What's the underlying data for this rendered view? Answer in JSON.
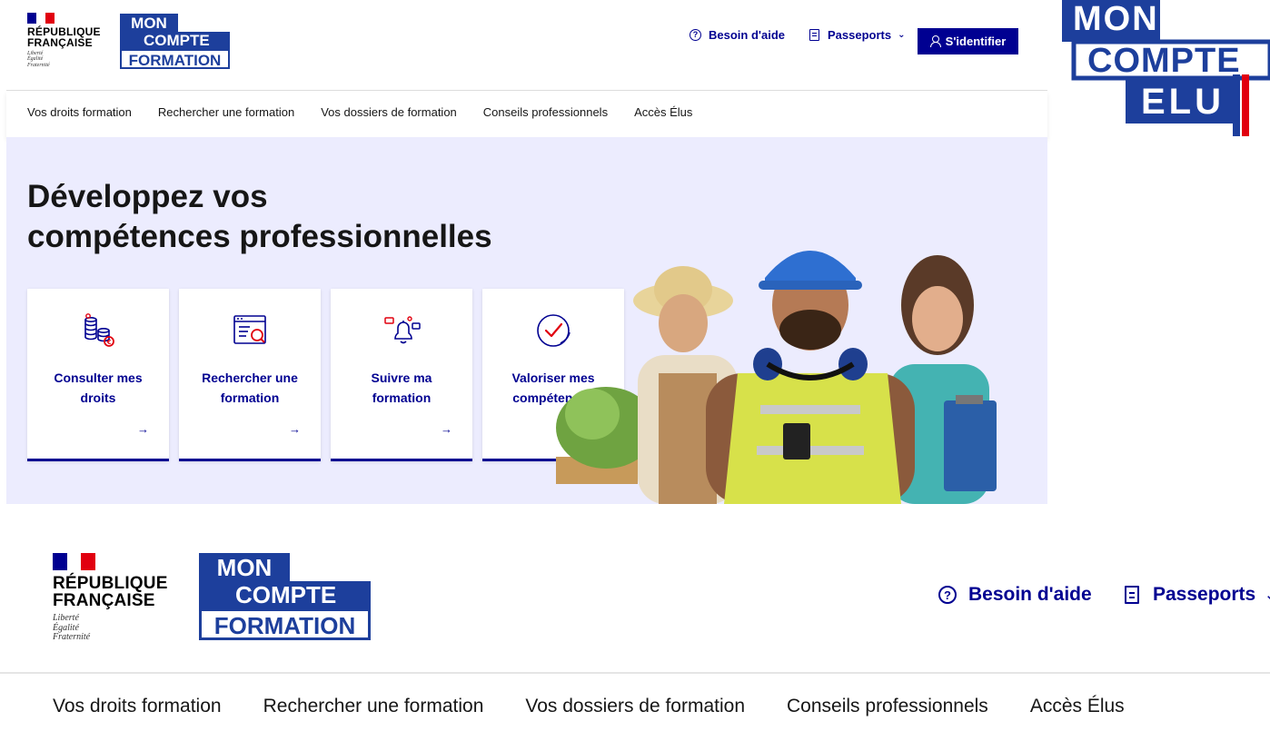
{
  "republic": {
    "line1": "RÉPUBLIQUE",
    "line2": "FRANÇAISE",
    "motto": [
      "Liberté",
      "Égalité",
      "Fraternité"
    ]
  },
  "logo": {
    "line1": "MON",
    "line2": "COMPTE",
    "line3": "FORMATION"
  },
  "header": {
    "help_label": "Besoin d'aide",
    "passports_label": "Passeports",
    "login_label": "S'identifier"
  },
  "nav": {
    "items": [
      "Vos droits formation",
      "Rechercher une formation",
      "Vos dossiers de formation",
      "Conseils professionnels",
      "Accès Élus"
    ]
  },
  "hero": {
    "title_line1": "Développez vos",
    "title_line2": "compétences professionnelles",
    "cards": [
      {
        "label_line1": "Consulter mes",
        "label_line2": "droits",
        "icon": "coins-icon",
        "action_icon": "arrow-right-icon"
      },
      {
        "label_line1": "Rechercher une",
        "label_line2": "formation",
        "icon": "search-document-icon",
        "action_icon": "arrow-right-icon"
      },
      {
        "label_line1": "Suivre ma",
        "label_line2": "formation",
        "icon": "bell-icon",
        "action_icon": "arrow-right-icon"
      },
      {
        "label_line1": "Valoriser mes",
        "label_line2": "compétences",
        "icon": "check-circle-icon",
        "action_icon": "external-link-icon"
      }
    ]
  },
  "elu_logo": {
    "line1": "MON",
    "line2": "COMPTE",
    "line3": "ELU"
  },
  "colors": {
    "primary": "#000091",
    "logo_blue": "#1d3f9c",
    "hero_bg": "#ececfe",
    "flag_red": "#e1000f"
  }
}
